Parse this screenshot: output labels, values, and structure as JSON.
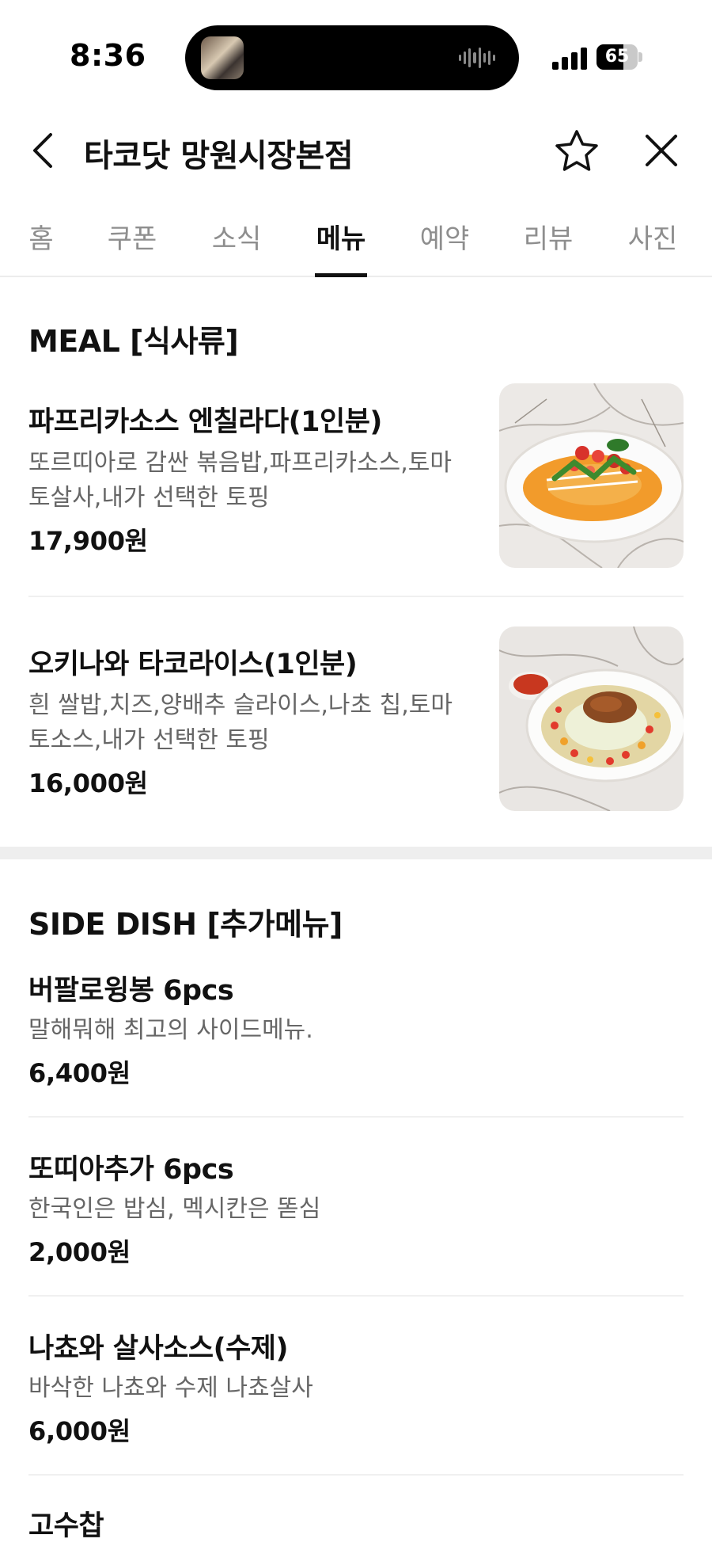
{
  "status_bar": {
    "time": "8:36",
    "battery": "65",
    "battery_level": 0.65
  },
  "header": {
    "title": "타코닷 망원시장본점"
  },
  "tabs": [
    {
      "label": "홈"
    },
    {
      "label": "쿠폰"
    },
    {
      "label": "소식"
    },
    {
      "label": "메뉴",
      "active": true
    },
    {
      "label": "예약"
    },
    {
      "label": "리뷰"
    },
    {
      "label": "사진"
    }
  ],
  "meal": {
    "title": "MEAL [식사류]",
    "items": [
      {
        "name": "파프리카소스 엔칠라다(1인분)",
        "desc_line1": "또르띠아로 감싼 볶음밥,파프리카소스,토마",
        "desc_line2": "토살사,내가 선택한 토핑",
        "price": "17,900원"
      },
      {
        "name": "오키나와 타코라이스(1인분)",
        "desc_line1": "흰 쌀밥,치즈,양배추 슬라이스,나초 칩,토마",
        "desc_line2": "토소스,내가 선택한 토핑",
        "price": "16,000원"
      }
    ]
  },
  "side": {
    "title": "SIDE DISH [추가메뉴]",
    "items": [
      {
        "name": "버팔로윙봉 6pcs",
        "desc": "말해뭐해 최고의 사이드메뉴.",
        "price": "6,400원"
      },
      {
        "name": "또띠아추가 6pcs",
        "desc": "한국인은 밥심, 멕시칸은 똗심",
        "price": "2,000원"
      },
      {
        "name": "나쵸와 살사소스(수제)",
        "desc": "바삭한 나쵸와 수제 나쵸살사",
        "price": "6,000원"
      },
      {
        "name": "고수찹"
      }
    ]
  },
  "icons": {
    "back": "chevron-left-icon",
    "favorite": "star-outline-icon",
    "close": "close-icon"
  },
  "colors": {
    "text": "#111111",
    "muted": "#666666",
    "tab_inactive": "#8e8e8e",
    "divider": "#eeeeee"
  }
}
